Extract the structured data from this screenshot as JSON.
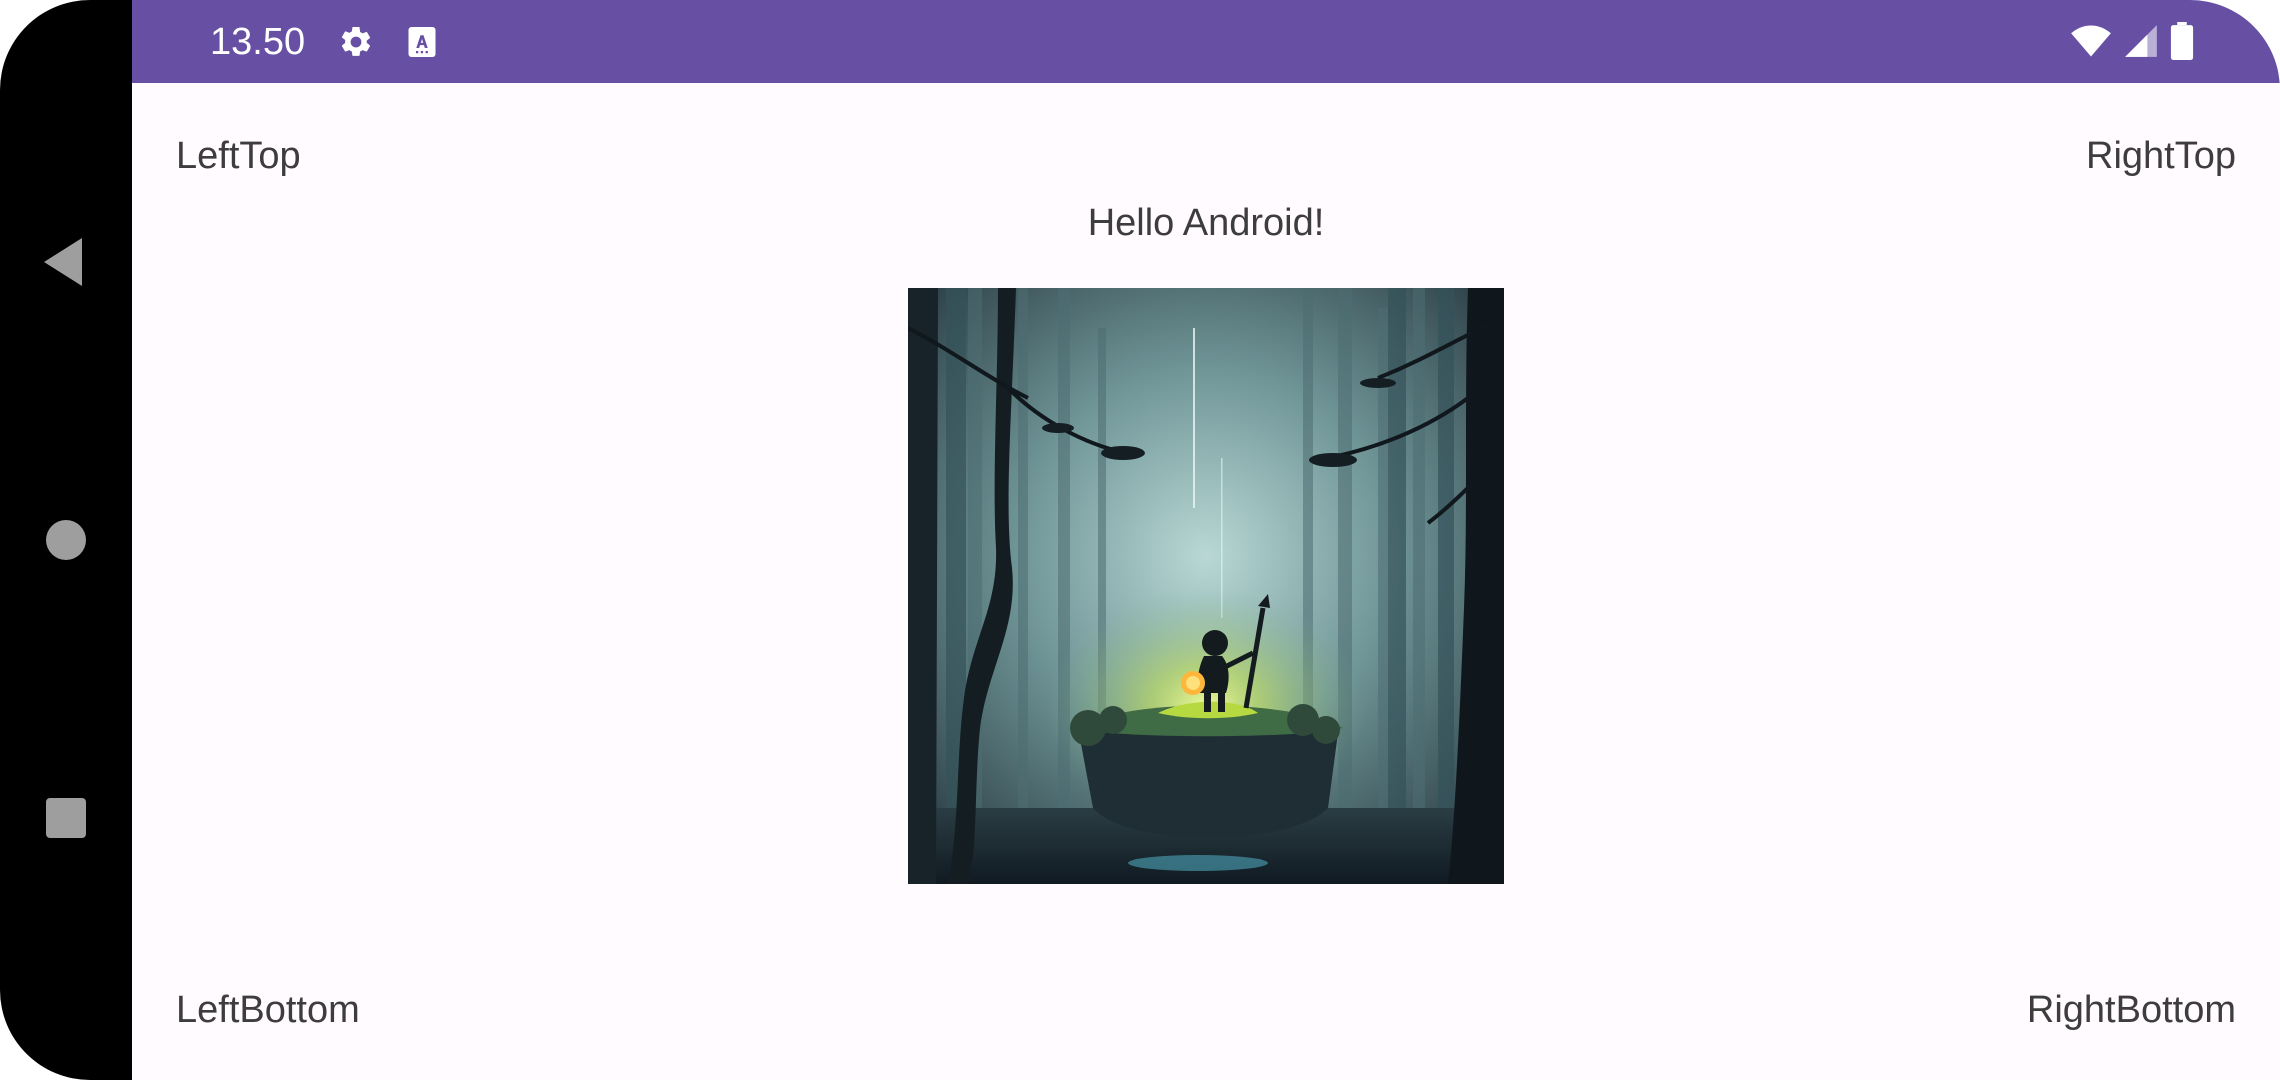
{
  "status_bar": {
    "time": "13.50",
    "icons": [
      "settings-gear-icon",
      "auto-text-icon",
      "wifi-icon",
      "cellular-signal-icon",
      "battery-icon"
    ],
    "background": "#6750a4"
  },
  "navigation": {
    "buttons": [
      "back-icon",
      "home-icon",
      "recents-icon"
    ]
  },
  "content": {
    "left_top": "LeftTop",
    "right_top": "RightTop",
    "greeting": "Hello Android!",
    "left_bottom": "LeftBottom",
    "right_bottom": "RightBottom"
  },
  "colors": {
    "surface": "#fffbfe",
    "text": "#3d3d3d",
    "accent": "#6750a4"
  }
}
